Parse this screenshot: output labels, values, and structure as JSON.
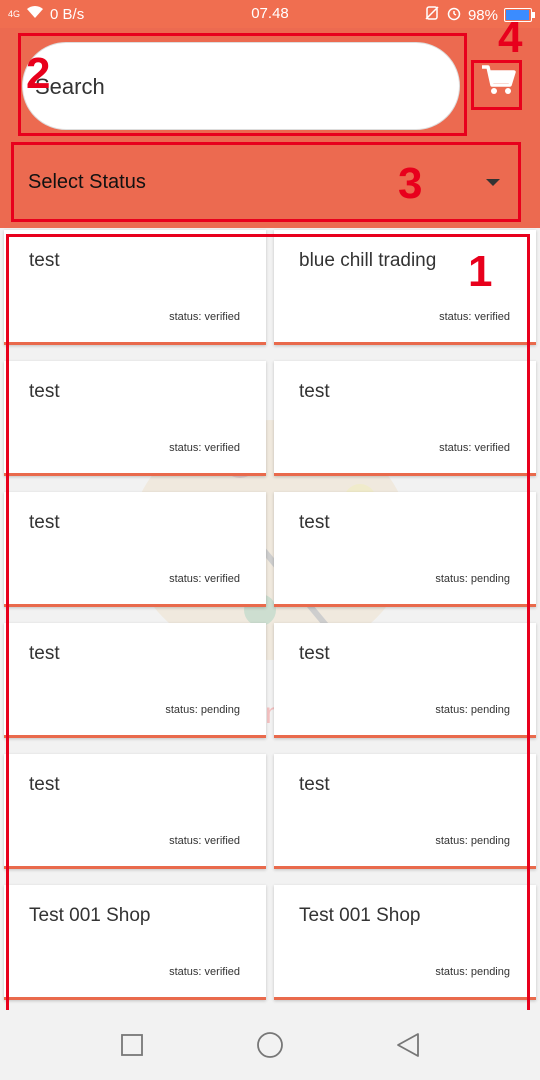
{
  "status_bar": {
    "signal": "4G",
    "network_speed": "0 B/s",
    "time": "07.48",
    "battery": "98%"
  },
  "search": {
    "placeholder": "Search"
  },
  "status_filter": {
    "selected": "Select Status"
  },
  "annotations": [
    "1",
    "2",
    "3",
    "4"
  ],
  "cards": [
    {
      "title": "test",
      "status": "status: verified"
    },
    {
      "title": "blue chill trading",
      "status": "status: verified"
    },
    {
      "title": "test",
      "status": "status: verified"
    },
    {
      "title": "test",
      "status": "status: verified"
    },
    {
      "title": "test",
      "status": "status: verified"
    },
    {
      "title": "test",
      "status": "status: pending"
    },
    {
      "title": "test",
      "status": "status: pending"
    },
    {
      "title": "test",
      "status": "status: pending"
    },
    {
      "title": "test",
      "status": "status: verified"
    },
    {
      "title": "test",
      "status": "status: pending"
    },
    {
      "title": "Test 001 Shop",
      "status": "status: verified"
    },
    {
      "title": "Test 001 Shop",
      "status": "status: pending"
    }
  ],
  "watermark": "Paint S",
  "colors": {
    "header": "#ec6a50",
    "annotation": "#e8001c",
    "card_accent": "#e96a4c"
  },
  "icons": [
    "wifi-icon",
    "cart-icon",
    "dropdown-caret-icon",
    "nav-recents-icon",
    "nav-home-icon",
    "nav-back-icon",
    "alarm-icon",
    "silent-icon",
    "battery-icon"
  ]
}
